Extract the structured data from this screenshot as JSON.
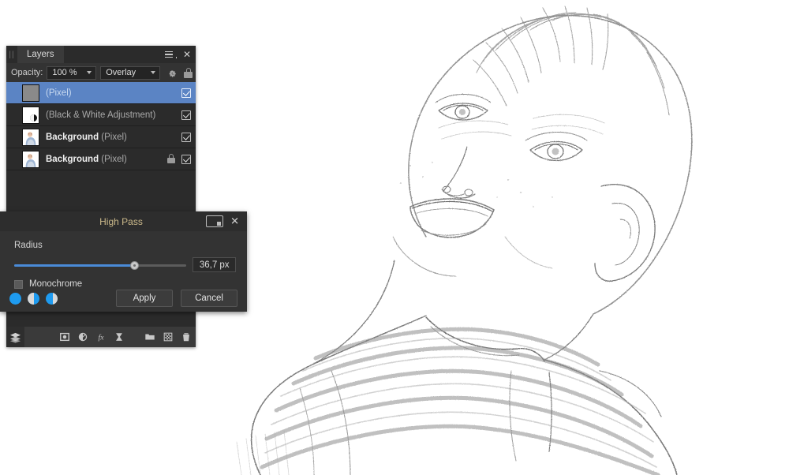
{
  "app": {
    "accent_blue": "#4a8bd8",
    "selection_blue": "#5b84c4",
    "panel_bg": "#2b2b2b",
    "dialog_bg": "#333333",
    "title_text_color": "#cbb98a"
  },
  "layers_panel": {
    "tab_label": "Layers",
    "menu_icon": "hamburger-menu-icon",
    "close_icon": "close-icon",
    "grip_icon": "drag-grip-icon",
    "opacity": {
      "label": "Opacity:",
      "value": "100 %",
      "blend_mode": "Overlay",
      "gear_icon": "gear-icon",
      "lock_icon": "lock-icon"
    },
    "layers": [
      {
        "name": "",
        "type": "(Pixel)",
        "selected": true,
        "locked": false,
        "visible": true,
        "thumb": "gray"
      },
      {
        "name": "",
        "type": "(Black & White Adjustment)",
        "selected": false,
        "locked": false,
        "visible": true,
        "thumb": "bw"
      },
      {
        "name": "Background",
        "type": "(Pixel)",
        "selected": false,
        "locked": false,
        "visible": true,
        "thumb": "photo"
      },
      {
        "name": "Background",
        "type": "(Pixel)",
        "selected": false,
        "locked": true,
        "visible": true,
        "thumb": "photo"
      }
    ],
    "toolbar": {
      "layers_stack_icon": "layers-stack-icon",
      "buttons": [
        {
          "icon": "mask-icon",
          "label": "Mask Layer"
        },
        {
          "icon": "adjustment-icon",
          "label": "Adjustment Layer"
        },
        {
          "icon": "fx-icon",
          "label": "Layer Effects"
        },
        {
          "icon": "live-filter-icon",
          "label": "Live Filter Layer"
        },
        {
          "icon": "folder-icon",
          "label": "New Group"
        },
        {
          "icon": "new-layer-icon",
          "label": "New Pixel Layer"
        },
        {
          "icon": "trash-icon",
          "label": "Delete Layer"
        }
      ]
    }
  },
  "high_pass_dialog": {
    "title": "High Pass",
    "preview_split_icon": "preview-split-icon",
    "close_icon": "close-icon",
    "radius": {
      "label": "Radius",
      "value": "36,7 px",
      "slider_percent": 70
    },
    "monochrome": {
      "label": "Monochrome",
      "checked": false
    },
    "preview_modes": [
      {
        "icon": "preview-full-icon",
        "label": "Preview after"
      },
      {
        "icon": "preview-split-v-icon",
        "label": "Split preview"
      },
      {
        "icon": "preview-mirror-icon",
        "label": "Mirrored split preview"
      }
    ],
    "apply_label": "Apply",
    "cancel_label": "Cancel"
  }
}
